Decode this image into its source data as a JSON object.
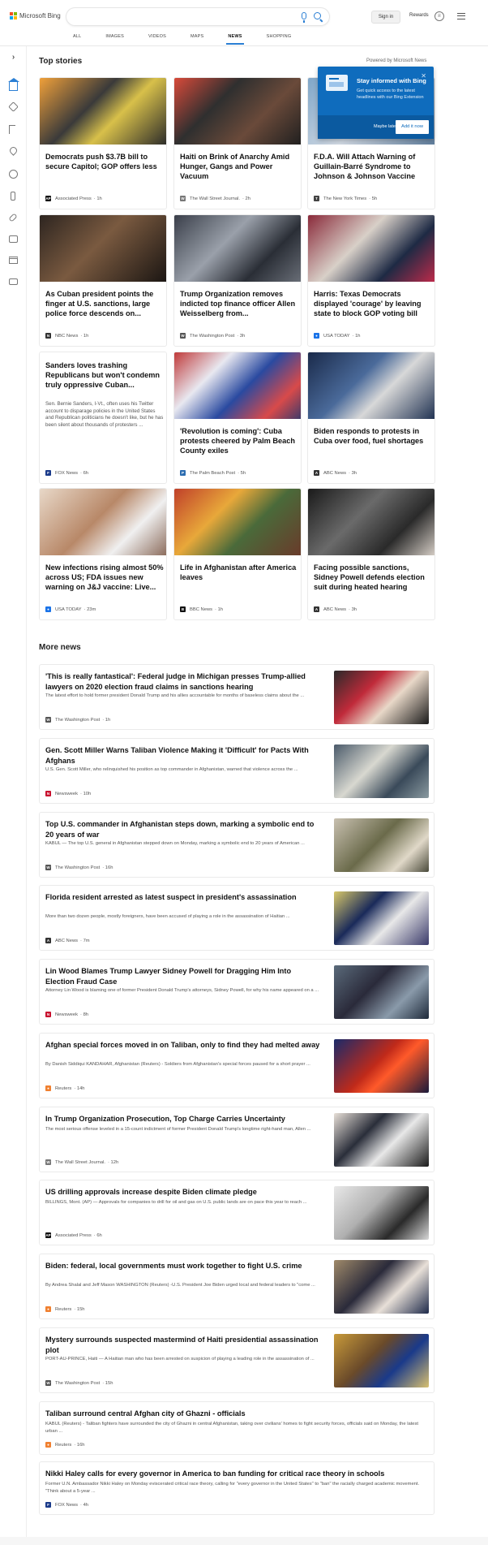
{
  "header": {
    "logo_text": "Microsoft Bing",
    "signin": "Sign in",
    "rewards": "Rewards",
    "tabs": [
      {
        "label": "ALL"
      },
      {
        "label": "IMAGES"
      },
      {
        "label": "VIDEOS"
      },
      {
        "label": "MAPS"
      },
      {
        "label": "NEWS"
      },
      {
        "label": "SHOPPING"
      }
    ]
  },
  "colors": {
    "accent": "#2b7fd4",
    "toast": "#0f6cbd"
  },
  "top_stories": {
    "title": "Top stories",
    "powered": "Powered by Microsoft News",
    "cards": [
      {
        "title": "Democrats push $3.7B bill to secure Capitol; GOP offers less",
        "source": "Associated Press",
        "time": "· 1h"
      },
      {
        "title": "Haiti on Brink of Anarchy Amid Hunger, Gangs and Power Vacuum",
        "source": "The Wall Street Journal.",
        "time": "· 2h"
      },
      {
        "title": "F.D.A. Will Attach Warning of Guillain-Barré Syndrome to Johnson & Johnson Vaccine",
        "source": "The New York Times",
        "time": "· 5h"
      },
      {
        "title": "As Cuban president points the finger at U.S. sanctions, large police force descends on...",
        "source": "NBC News",
        "time": "· 1h"
      },
      {
        "title": "Trump Organization removes indicted top finance officer Allen Weisselberg from...",
        "source": "The Washington Post",
        "time": "· 3h"
      },
      {
        "title": "Harris: Texas Democrats displayed 'courage' by leaving state to block GOP voting bill",
        "source": "USA TODAY",
        "time": "· 1h"
      },
      {
        "title": "Sanders loves trashing Republicans but won't condemn truly oppressive Cuban...",
        "snippet": "Sen. Bernie Sanders, I-Vt., often uses his Twitter account to disparage policies in the United States and Republican politicians he doesn't like, but he has been silent about thousands of protesters ...",
        "source": "FOX News",
        "time": "· 6h"
      },
      {
        "title": "'Revolution is coming': Cuba protests cheered by Palm Beach County exiles",
        "source": "The Palm Beach Post",
        "time": "· 5h"
      },
      {
        "title": "Biden responds to protests in Cuba over food, fuel shortages",
        "source": "ABC News",
        "time": "· 3h"
      },
      {
        "title": "New infections rising almost 50% across US; FDA issues new warning on J&J vaccine: Live...",
        "source": "USA TODAY",
        "time": "· 23m"
      },
      {
        "title": "Life in Afghanistan after America leaves",
        "source": "BBC News",
        "time": "· 1h"
      },
      {
        "title": "Facing possible sanctions, Sidney Powell defends election suit during heated hearing",
        "source": "ABC News",
        "time": "· 3h"
      }
    ]
  },
  "toast": {
    "title": "Stay informed with Bing",
    "body": "Get quick access to the latest headlines with our Bing Extension",
    "later": "Maybe later",
    "add": "Add it now",
    "close": "✕"
  },
  "more_news": {
    "title": "More news",
    "items": [
      {
        "title": "'This is really fantastical': Federal judge in Michigan presses Trump-allied lawyers on 2020 election fraud claims in sanctions hearing",
        "snippet": "The latest effort to hold former president Donald Trump and his allies accountable for months of baseless claims about the ...",
        "source": "The Washington Post",
        "time": "· 1h"
      },
      {
        "title": "Gen. Scott Miller Warns Taliban Violence Making it 'Difficult' for Pacts With Afghans",
        "snippet": "U.S. Gen. Scott Miller, who relinquished his position as top commander in Afghanistan, warned that violence across the ...",
        "source": "Newsweek",
        "time": "· 10h"
      },
      {
        "title": "Top U.S. commander in Afghanistan steps down, marking a symbolic end to 20 years of war",
        "snippet": "KABUL — The top U.S. general in Afghanistan stepped down on Monday, marking a symbolic end to 20 years of American ...",
        "source": "The Washington Post",
        "time": "· 16h"
      },
      {
        "title": "Florida resident arrested as latest suspect in president's assassination",
        "snippet": "More than two dozen people, mostly foreigners, have been accused of playing a role in the assassination of Haitian ...",
        "source": "ABC News",
        "time": "· 7m"
      },
      {
        "title": "Lin Wood Blames Trump Lawyer Sidney Powell for Dragging Him Into Election Fraud Case",
        "snippet": "Attorney Lin Wood is blaming one of former President Donald Trump's attorneys, Sidney Powell, for why his name appeared on a ...",
        "source": "Newsweek",
        "time": "· 8h"
      },
      {
        "title": "Afghan special forces moved in on Taliban, only to find they had melted away",
        "snippet": "By Danish Siddiqui KANDAHAR, Afghanistan (Reuters) - Soldiers from Afghanistan's special forces paused for a short prayer ...",
        "source": "Reuters",
        "time": "· 14h"
      },
      {
        "title": "In Trump Organization Prosecution, Top Charge Carries Uncertainty",
        "snippet": "The most serious offense leveled in a 15-count indictment of former President Donald Trump's longtime right-hand man, Allen ...",
        "source": "The Wall Street Journal.",
        "time": "· 12h"
      },
      {
        "title": "US drilling approvals increase despite Biden climate pledge",
        "snippet": "BILLINGS, Mont. (AP) — Approvals for companies to drill for oil and gas on U.S. public lands are on pace this year to reach ...",
        "source": "Associated Press",
        "time": "· 6h"
      },
      {
        "title": "Biden: federal, local governments must work together to fight U.S. crime",
        "snippet": "By Andrea Shalal and Jeff Mason WASHINGTON (Reuters) -U.S. President Joe Biden urged local and federal leaders to \"come ...",
        "source": "Reuters",
        "time": "· 15h"
      },
      {
        "title": "Mystery surrounds suspected mastermind of Haiti presidential assassination plot",
        "snippet": "PORT-AU-PRINCE, Haiti — A Haitian man who has been arrested on suspicion of playing a leading role in the assassination of ...",
        "source": "The Washington Post",
        "time": "· 15h"
      },
      {
        "title": "Taliban surround central Afghan city of Ghazni - officials",
        "snippet": "KABUL (Reuters) - Taliban fighters have surrounded the city of Ghazni in central Afghanistan, taking over civilians' homes to fight security forces, officials said on Monday, the latest urban ...",
        "source": "Reuters",
        "time": "· 16h"
      },
      {
        "title": "Nikki Haley calls for every governor in America to ban funding for critical race theory in schools",
        "snippet": "Former U.N. Ambassador Nikki Haley on Monday eviscerated critical race theory, calling for \"every governor in the United States\" to \"ban\" the racially charged academic movement. \"Think about a 5-year ...",
        "source": "FOX News",
        "time": "· 4h"
      }
    ]
  }
}
